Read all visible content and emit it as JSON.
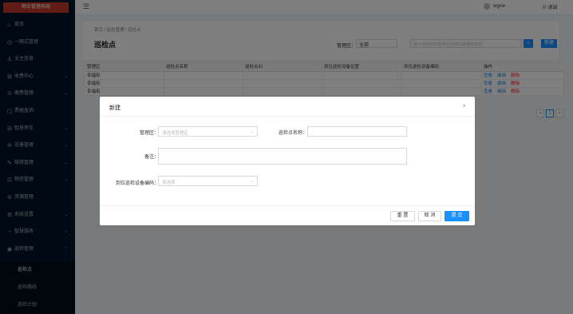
{
  "sidebar": {
    "logo": "物业管理系统",
    "items": [
      {
        "icon": "⌂",
        "label": "首页",
        "chev": ""
      },
      {
        "icon": "◷",
        "label": "一图式管理",
        "chev": ""
      },
      {
        "icon": "♙",
        "label": "业主信息",
        "chev": ""
      },
      {
        "icon": "⊞",
        "label": "收费中心",
        "chev": "⌄"
      },
      {
        "icon": "⊙",
        "label": "缴费管理",
        "chev": "⌄"
      },
      {
        "icon": "▢",
        "label": "票据查询",
        "chev": ""
      },
      {
        "icon": "⊟",
        "label": "智慧停车",
        "chev": "⌄"
      },
      {
        "icon": "⊖",
        "label": "设备管理",
        "chev": "⌄"
      },
      {
        "icon": "✎",
        "label": "维修管理",
        "chev": "⌄"
      },
      {
        "icon": "⊡",
        "label": "物资管理",
        "chev": "⌄"
      },
      {
        "icon": "⊘",
        "label": "资源管理",
        "chev": ""
      },
      {
        "icon": "⚙",
        "label": "系统设置",
        "chev": "⌄"
      },
      {
        "icon": "◔",
        "label": "智慧服务",
        "chev": "⌄"
      },
      {
        "icon": "◉",
        "label": "巡检管理",
        "chev": "⌃"
      }
    ],
    "sub_items": [
      "巡检点",
      "巡检路线",
      "巡检计划"
    ]
  },
  "header": {
    "hamburger": "☰",
    "username": "wgxw",
    "logout": "⊖ 退出"
  },
  "page": {
    "breadcrumb": "首页  /  巡检管理  /  巡检点",
    "title": "巡检点",
    "filter_label": "管理区：",
    "filter_value": "全部",
    "search_placeholder": "输入巡检点名称/到位巡检设备编码查找",
    "search_icon": "🔍",
    "add_label": "新建"
  },
  "table": {
    "headers": [
      "管理区",
      "巡检点名称",
      "巡检点ID",
      "到位巡检设备位置",
      "到位巡检设备编码",
      "操作"
    ],
    "rows": [
      [
        "幸福街",
        "",
        "",
        "",
        ""
      ],
      [
        "幸福街",
        "",
        "",
        "",
        ""
      ],
      [
        "幸福街",
        "",
        "",
        "",
        ""
      ]
    ],
    "op_view": "查看",
    "op_edit": "编辑",
    "op_delete": "删除"
  },
  "pager": {
    "prev": "‹",
    "current": "1",
    "next": "›"
  },
  "modal": {
    "title": "新建",
    "close": "×",
    "area_label": "管理区：",
    "area_placeholder": "请选择管理区",
    "name_label": "巡检点名称：",
    "remark_label": "备注：",
    "device_label": "到位巡检设备编码：",
    "device_placeholder": "请选择",
    "reset_label": "重 置",
    "cancel_label": "取 消",
    "submit_label": "提 交"
  }
}
